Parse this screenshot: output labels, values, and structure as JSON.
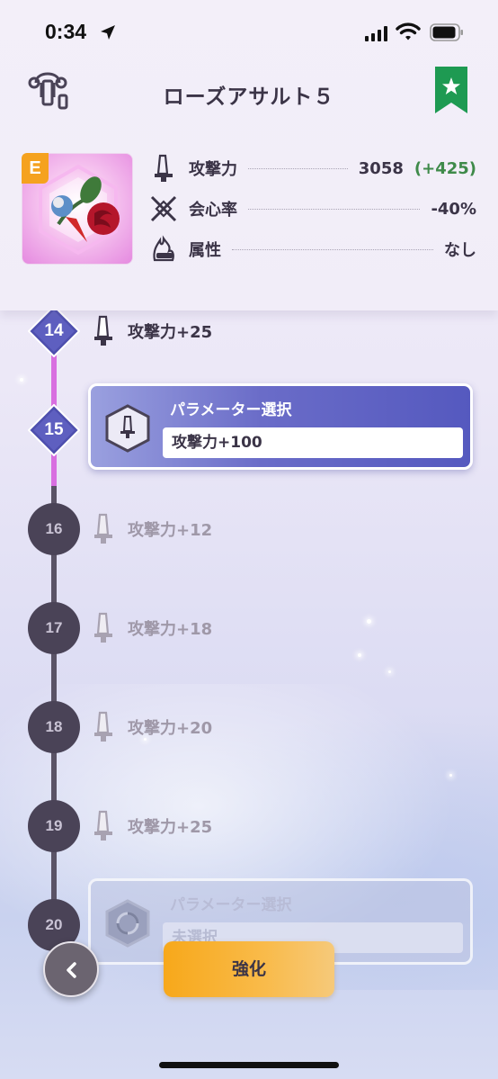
{
  "status_bar": {
    "time": "0:34"
  },
  "header": {
    "title": "ローズアサルト５",
    "rank": "E",
    "stats": [
      {
        "icon": "sword-icon",
        "label": "攻撃力",
        "value": "3058",
        "bonus": "(+425)"
      },
      {
        "icon": "crossed-swords-icon",
        "label": "会心率",
        "value": "-40%"
      },
      {
        "icon": "flame-fist-icon",
        "label": "属性",
        "value": "なし"
      }
    ]
  },
  "timeline": {
    "levels": [
      {
        "level": "14",
        "text": "攻撃力+25",
        "state": "done"
      },
      {
        "level": "15",
        "title": "パラメーター選択",
        "field": "攻撃力+100",
        "state": "done-select"
      },
      {
        "level": "16",
        "text": "攻撃力+12",
        "state": "locked"
      },
      {
        "level": "17",
        "text": "攻撃力+18",
        "state": "locked"
      },
      {
        "level": "18",
        "text": "攻撃力+20",
        "state": "locked"
      },
      {
        "level": "19",
        "text": "攻撃力+25",
        "state": "locked"
      },
      {
        "level": "20",
        "title": "パラメーター選択",
        "field": "未選択",
        "state": "locked-select"
      }
    ]
  },
  "footer": {
    "enhance_label": "強化"
  },
  "colors": {
    "accent_purple": "#5559bf",
    "progress_pink": "#d86fe0",
    "enhance_orange": "#f7a81a",
    "bookmark_green": "#1e9a52"
  }
}
